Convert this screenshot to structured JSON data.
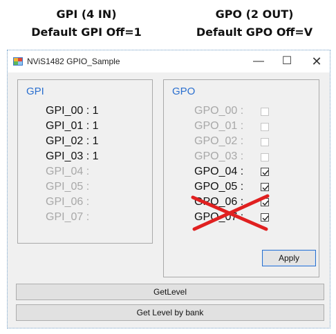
{
  "headings": {
    "gpi_title": "GPI (4 IN)",
    "gpi_default": "Default GPI Off=1",
    "gpo_title": "GPO (2 OUT)",
    "gpo_default": "Default GPO Off=V"
  },
  "window": {
    "title": "NViS1482 GPIO_Sample",
    "minimize_glyph": "—",
    "maximize_glyph": "☐",
    "close_glyph": "✕"
  },
  "gpi": {
    "title": "GPI",
    "rows": [
      {
        "label": "GPI_00 : 1",
        "active": true
      },
      {
        "label": "GPI_01 : 1",
        "active": true
      },
      {
        "label": "GPI_02 : 1",
        "active": true
      },
      {
        "label": "GPI_03 : 1",
        "active": true
      },
      {
        "label": "GPI_04 :",
        "active": false
      },
      {
        "label": "GPI_05 :",
        "active": false
      },
      {
        "label": "GPI_06 :",
        "active": false
      },
      {
        "label": "GPI_07 :",
        "active": false
      }
    ]
  },
  "gpo": {
    "title": "GPO",
    "rows": [
      {
        "label": "GPO_00 :",
        "active": false,
        "checked": false
      },
      {
        "label": "GPO_01 :",
        "active": false,
        "checked": false
      },
      {
        "label": "GPO_02 :",
        "active": false,
        "checked": false
      },
      {
        "label": "GPO_03 :",
        "active": false,
        "checked": false
      },
      {
        "label": "GPO_04 :",
        "active": true,
        "checked": true
      },
      {
        "label": "GPO_05 :",
        "active": true,
        "checked": true
      },
      {
        "label": "GPO_06 :",
        "active": true,
        "checked": true
      },
      {
        "label": "GPO_07 :",
        "active": true,
        "checked": true
      }
    ],
    "apply_label": "Apply"
  },
  "buttons": {
    "get_level": "GetLevel",
    "get_level_by_bank": "Get Level by bank"
  },
  "colors": {
    "group_title": "#2a6fcf",
    "strike_mark": "#e02020"
  }
}
